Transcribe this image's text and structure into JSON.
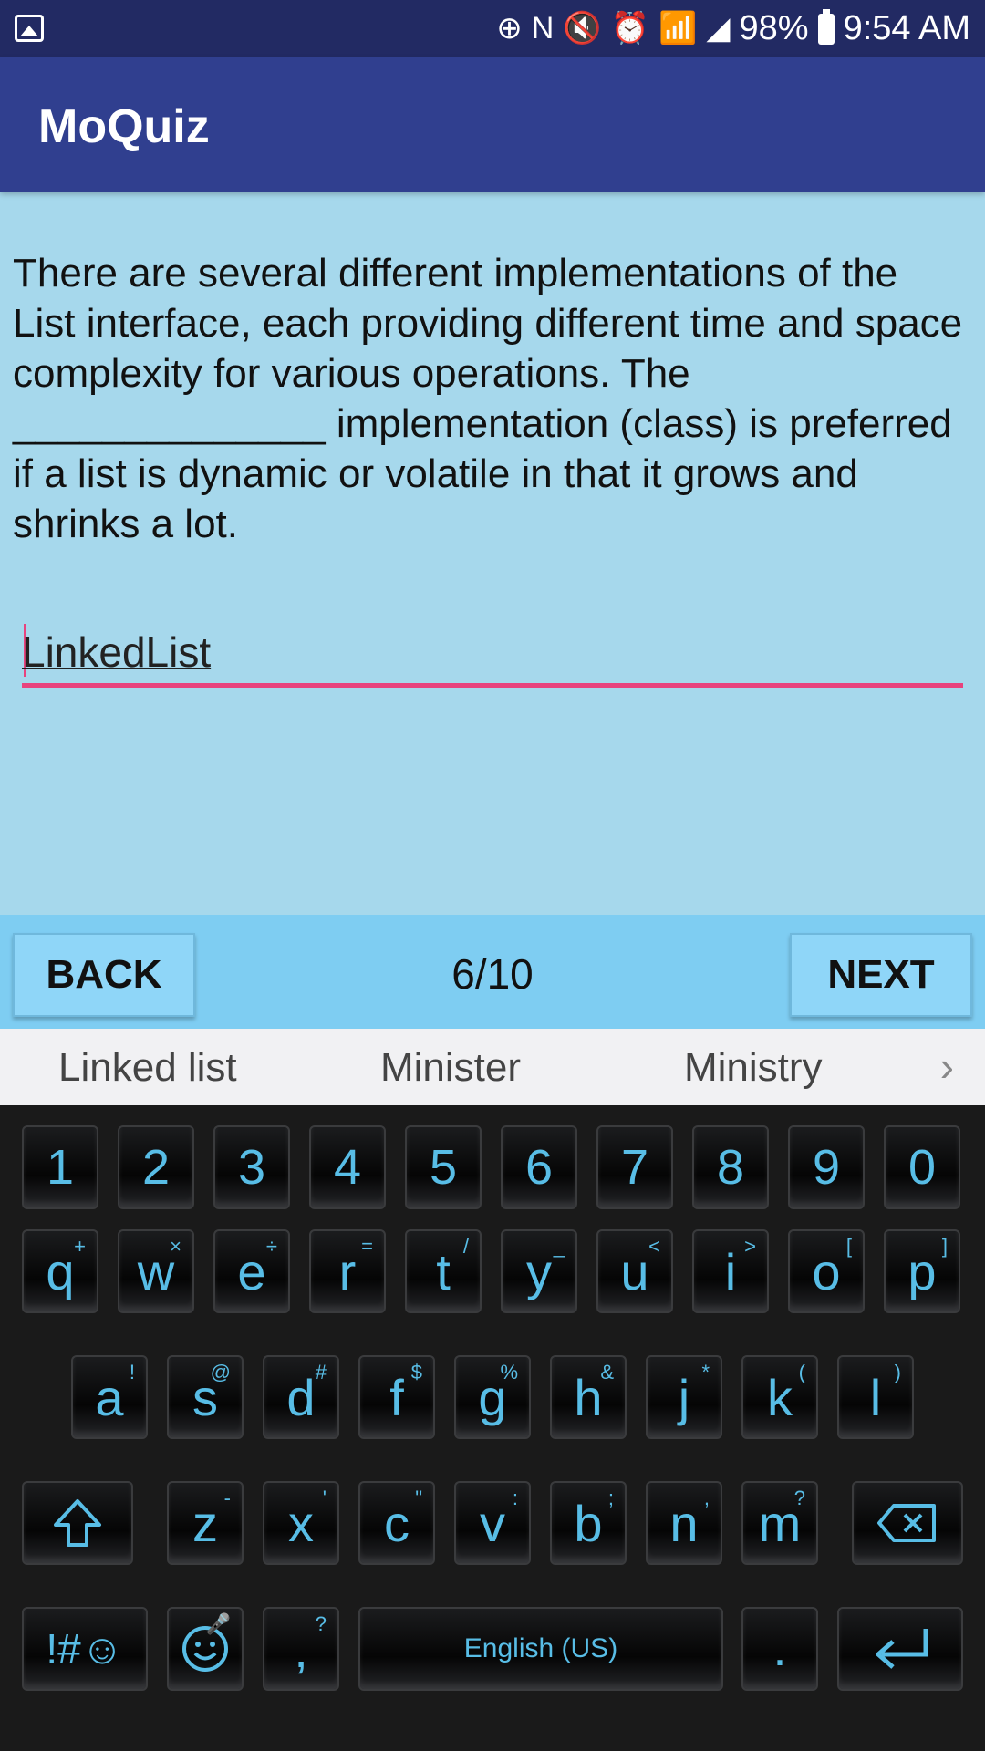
{
  "status_bar": {
    "battery": "98%",
    "time": "9:54 AM"
  },
  "app_bar": {
    "title": "MoQuiz"
  },
  "question": {
    "text": "There are several different implementations of the List interface, each providing different time and space complexity for various operations. The ______________ implementation (class) is preferred if a list is dynamic or volatile in that it grows and shrinks a lot."
  },
  "answer": {
    "value": "LinkedList"
  },
  "navigation": {
    "back_label": "BACK",
    "progress": "6/10",
    "next_label": "NEXT"
  },
  "suggestions": [
    "Linked list",
    "Minister",
    "Ministry"
  ],
  "keyboard": {
    "number_row": [
      "1",
      "2",
      "3",
      "4",
      "5",
      "6",
      "7",
      "8",
      "9",
      "0"
    ],
    "row1": [
      {
        "k": "q",
        "s": "+"
      },
      {
        "k": "w",
        "s": "×"
      },
      {
        "k": "e",
        "s": "÷"
      },
      {
        "k": "r",
        "s": "="
      },
      {
        "k": "t",
        "s": "/"
      },
      {
        "k": "y",
        "s": "_"
      },
      {
        "k": "u",
        "s": "<"
      },
      {
        "k": "i",
        "s": ">"
      },
      {
        "k": "o",
        "s": "["
      },
      {
        "k": "p",
        "s": "]"
      }
    ],
    "row2": [
      {
        "k": "a",
        "s": "!"
      },
      {
        "k": "s",
        "s": "@"
      },
      {
        "k": "d",
        "s": "#"
      },
      {
        "k": "f",
        "s": "$"
      },
      {
        "k": "g",
        "s": "%"
      },
      {
        "k": "h",
        "s": "&"
      },
      {
        "k": "j",
        "s": "*"
      },
      {
        "k": "k",
        "s": "("
      },
      {
        "k": "l",
        "s": ")"
      }
    ],
    "row3": [
      {
        "k": "z",
        "s": "-"
      },
      {
        "k": "x",
        "s": "'"
      },
      {
        "k": "c",
        "s": "\""
      },
      {
        "k": "v",
        "s": ":"
      },
      {
        "k": "b",
        "s": ";"
      },
      {
        "k": "n",
        "s": ","
      },
      {
        "k": "m",
        "s": "?"
      }
    ],
    "symbols_label": "!#☺",
    "comma_label": ",",
    "comma_sub": "?",
    "space_label": "English (US)",
    "period_label": "."
  }
}
